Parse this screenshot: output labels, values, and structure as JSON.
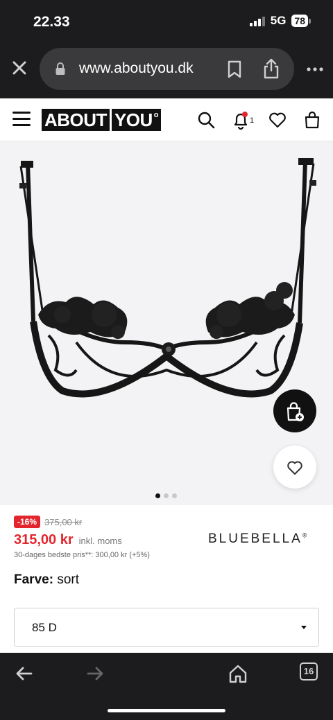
{
  "status_bar": {
    "time": "22.33",
    "network": "5G",
    "battery": "78"
  },
  "browser": {
    "url": "www.aboutyou.dk",
    "icons": [
      "close-icon",
      "lock-icon",
      "bookmark-icon",
      "share-icon",
      "more-icon"
    ],
    "bottom_nav": {
      "icons": [
        "back-arrow-icon",
        "forward-arrow-icon",
        "home-icon",
        "tabs-icon"
      ],
      "tab_count": "16"
    }
  },
  "site": {
    "logo_left": "ABOUT",
    "logo_right": "YOU",
    "logo_mark": "o",
    "notification_count": "1",
    "icons": [
      "menu-icon",
      "search-icon",
      "bell-icon",
      "heart-icon",
      "bag-icon"
    ]
  },
  "gallery": {
    "image_count": 3,
    "active_index": 0
  },
  "product": {
    "discount_badge": "-16%",
    "old_price": "375,00 kr",
    "price": "315,00 kr",
    "vat_note": "inkl. moms",
    "best_price_note": "30-dages bedste pris**: 300,00 kr (+5%)",
    "brand": "BLUEBELLA",
    "brand_mark": "®",
    "color_label": "Farve:",
    "color_value": "sort",
    "size_selected": "85 D"
  },
  "colors": {
    "sale_red": "#e3262e",
    "chrome_dark": "#1c1c1e",
    "image_bg": "#f3f3f5"
  }
}
